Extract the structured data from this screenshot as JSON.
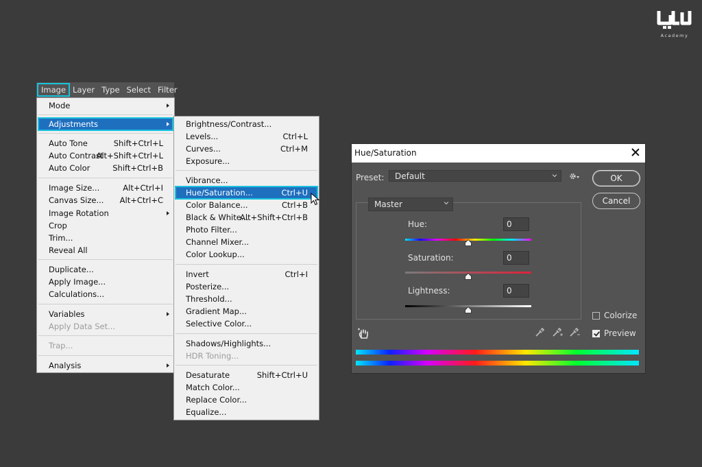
{
  "brand": {
    "logo_text": "کیلا",
    "sub": "Academy"
  },
  "menubar": [
    {
      "label": "Image",
      "highlighted": true
    },
    {
      "label": "Layer"
    },
    {
      "label": "Type"
    },
    {
      "label": "Select"
    },
    {
      "label": "Filter"
    }
  ],
  "image_menu": {
    "mode": "Mode",
    "adjustments": "Adjustments",
    "auto_tone": {
      "label": "Auto Tone",
      "shortcut": "Shift+Ctrl+L"
    },
    "auto_contrast": {
      "label": "Auto Contrast",
      "shortcut": "Alt+Shift+Ctrl+L"
    },
    "auto_color": {
      "label": "Auto Color",
      "shortcut": "Shift+Ctrl+B"
    },
    "image_size": {
      "label": "Image Size...",
      "shortcut": "Alt+Ctrl+I"
    },
    "canvas_size": {
      "label": "Canvas Size...",
      "shortcut": "Alt+Ctrl+C"
    },
    "image_rotation": "Image Rotation",
    "crop": "Crop",
    "trim": "Trim...",
    "reveal_all": "Reveal All",
    "duplicate": "Duplicate...",
    "apply_image": "Apply Image...",
    "calculations": "Calculations...",
    "variables": "Variables",
    "apply_data_set": "Apply Data Set...",
    "trap": "Trap...",
    "analysis": "Analysis"
  },
  "adjustments_menu": {
    "brightness_contrast": "Brightness/Contrast...",
    "levels": {
      "label": "Levels...",
      "shortcut": "Ctrl+L"
    },
    "curves": {
      "label": "Curves...",
      "shortcut": "Ctrl+M"
    },
    "exposure": "Exposure...",
    "vibrance": "Vibrance...",
    "hue_saturation": {
      "label": "Hue/Saturation...",
      "shortcut": "Ctrl+U"
    },
    "color_balance": {
      "label": "Color Balance...",
      "shortcut": "Ctrl+B"
    },
    "black_white": {
      "label": "Black & White...",
      "shortcut": "Alt+Shift+Ctrl+B"
    },
    "photo_filter": "Photo Filter...",
    "channel_mixer": "Channel Mixer...",
    "color_lookup": "Color Lookup...",
    "invert": {
      "label": "Invert",
      "shortcut": "Ctrl+I"
    },
    "posterize": "Posterize...",
    "threshold": "Threshold...",
    "gradient_map": "Gradient Map...",
    "selective_color": "Selective Color...",
    "shadows_highlights": "Shadows/Highlights...",
    "hdr_toning": "HDR Toning...",
    "desaturate": {
      "label": "Desaturate",
      "shortcut": "Shift+Ctrl+U"
    },
    "match_color": "Match Color...",
    "replace_color": "Replace Color...",
    "equalize": "Equalize..."
  },
  "dialog": {
    "title": "Hue/Saturation",
    "preset_label": "Preset:",
    "preset_value": "Default",
    "ok": "OK",
    "cancel": "Cancel",
    "channel": "Master",
    "hue": {
      "label": "Hue:",
      "value": "0",
      "slider_fraction": 0.5
    },
    "saturation": {
      "label": "Saturation:",
      "value": "0",
      "slider_fraction": 0.5
    },
    "lightness": {
      "label": "Lightness:",
      "value": "0",
      "slider_fraction": 0.5
    },
    "colorize": {
      "label": "Colorize",
      "checked": false
    },
    "preview": {
      "label": "Preview",
      "checked": true
    }
  },
  "colors": {
    "background": "#3b3b3b",
    "highlight_outline": "#19c2dd",
    "menu_selection": "#1f6fbf",
    "dialog_bg": "#535353"
  },
  "icons": [
    "gear-icon",
    "hand-target-icon",
    "eyedropper-icon",
    "eyedropper-plus-icon",
    "eyedropper-minus-icon",
    "close-icon",
    "chevron-down-icon",
    "submenu-arrow-icon",
    "mouse-cursor-icon"
  ]
}
